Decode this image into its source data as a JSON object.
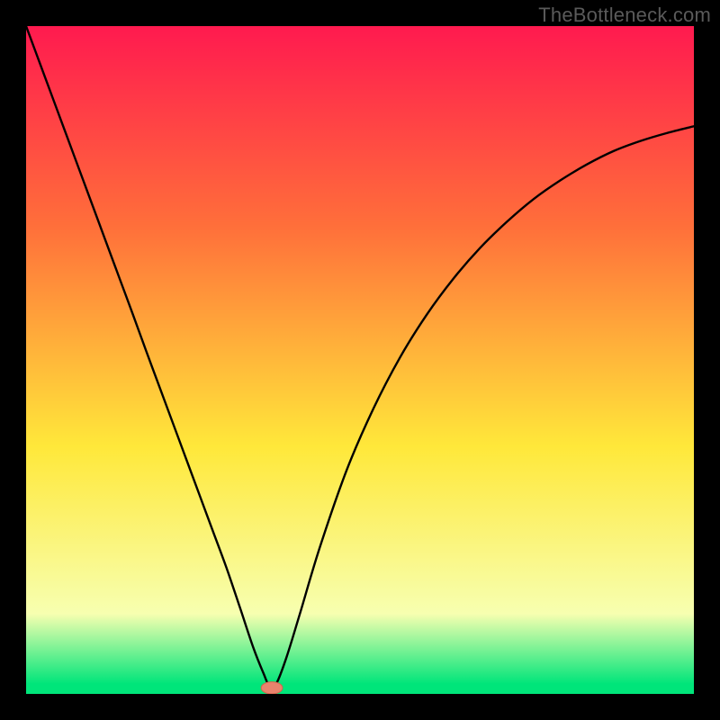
{
  "watermark": "TheBottleneck.com",
  "colors": {
    "frame": "#000000",
    "watermark": "#5a5a5a",
    "gradient_top": "#ff1a4f",
    "gradient_orange": "#ff6f3a",
    "gradient_yellow": "#ffe83a",
    "gradient_pale": "#f7ffb0",
    "gradient_green": "#00e57a",
    "curve": "#000000",
    "marker_fill": "#e9836d",
    "marker_stroke": "#d4644c"
  },
  "chart_data": {
    "type": "line",
    "title": "",
    "xlabel": "",
    "ylabel": "",
    "xlim": [
      0,
      100
    ],
    "ylim": [
      0,
      100
    ],
    "x": [
      0,
      2,
      4,
      6,
      8,
      10,
      12,
      14,
      16,
      18,
      20,
      22,
      24,
      26,
      28,
      30,
      32,
      34,
      35.5,
      36.5,
      37.5,
      39,
      41,
      44,
      48,
      52,
      56,
      60,
      64,
      68,
      72,
      76,
      80,
      84,
      88,
      92,
      96,
      100
    ],
    "values": [
      100,
      94.6,
      89.2,
      83.8,
      78.4,
      73.0,
      67.6,
      62.2,
      56.8,
      51.3,
      45.9,
      40.5,
      35.1,
      29.7,
      24.3,
      18.9,
      13.0,
      7.0,
      3.2,
      1.1,
      1.6,
      5.5,
      12.0,
      22.0,
      33.5,
      42.7,
      50.4,
      56.8,
      62.2,
      66.8,
      70.7,
      74.1,
      76.9,
      79.3,
      81.3,
      82.8,
      84.0,
      85.0
    ],
    "marker": {
      "x": 36.8,
      "y": 0.9,
      "rx": 1.6,
      "ry": 0.9
    },
    "gradient_stops": [
      {
        "offset": 0.0,
        "color_key": "gradient_top"
      },
      {
        "offset": 0.3,
        "color_key": "gradient_orange"
      },
      {
        "offset": 0.63,
        "color_key": "gradient_yellow"
      },
      {
        "offset": 0.88,
        "color_key": "gradient_pale"
      },
      {
        "offset": 0.985,
        "color_key": "gradient_green"
      }
    ]
  }
}
